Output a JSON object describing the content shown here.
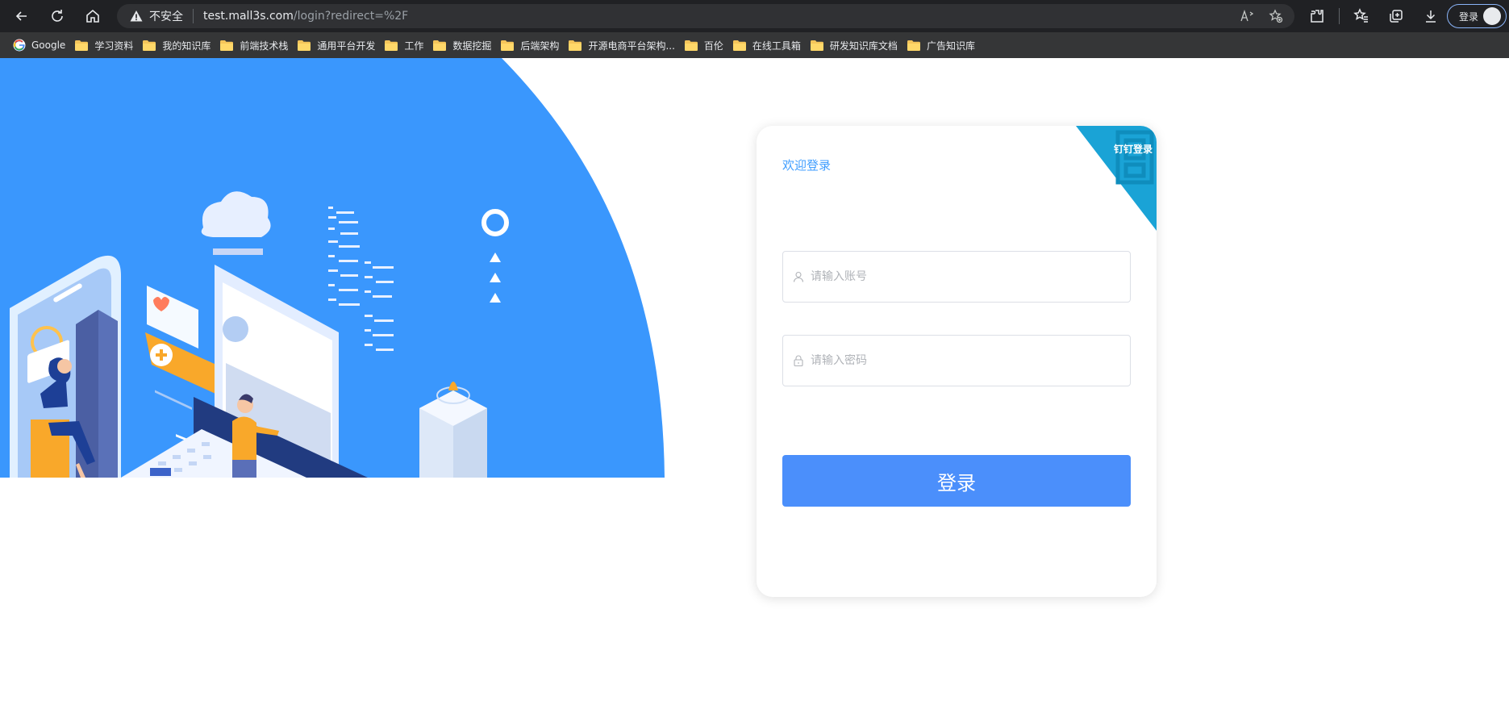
{
  "browser": {
    "insecure_label": "不安全",
    "url_host": "test.mall3s.com",
    "url_path": "/login?redirect=%2F",
    "profile_label": "登录",
    "icons": [
      "back-icon",
      "refresh-icon",
      "home-icon",
      "warning-icon",
      "read-aloud-icon",
      "add-favorite-icon",
      "extensions-icon",
      "favorites-icon",
      "collections-icon",
      "download-icon"
    ]
  },
  "bookmarks": [
    {
      "label": "Google",
      "icon": "google-icon"
    },
    {
      "label": "学习资料",
      "icon": "folder-icon"
    },
    {
      "label": "我的知识库",
      "icon": "folder-icon"
    },
    {
      "label": "前端技术栈",
      "icon": "folder-icon"
    },
    {
      "label": "通用平台开发",
      "icon": "folder-icon"
    },
    {
      "label": "工作",
      "icon": "folder-icon"
    },
    {
      "label": "数据挖掘",
      "icon": "folder-icon"
    },
    {
      "label": "后端架构",
      "icon": "folder-icon"
    },
    {
      "label": "开源电商平台架构...",
      "icon": "folder-icon"
    },
    {
      "label": "百伦",
      "icon": "folder-icon"
    },
    {
      "label": "在线工具箱",
      "icon": "folder-icon"
    },
    {
      "label": "研发知识库文档",
      "icon": "folder-icon"
    },
    {
      "label": "广告知识库",
      "icon": "folder-icon"
    }
  ],
  "login": {
    "welcome": "欢迎登录",
    "dingtalk_label": "钉钉登录",
    "username_placeholder": "请输入账号",
    "username_value": "",
    "password_placeholder": "请输入密码",
    "password_value": "",
    "submit_label": "登录"
  },
  "colors": {
    "hero_blue": "#3a97fd",
    "accent": "#409eff",
    "button": "#4b8ffb",
    "corner": "#1aa3d6"
  }
}
